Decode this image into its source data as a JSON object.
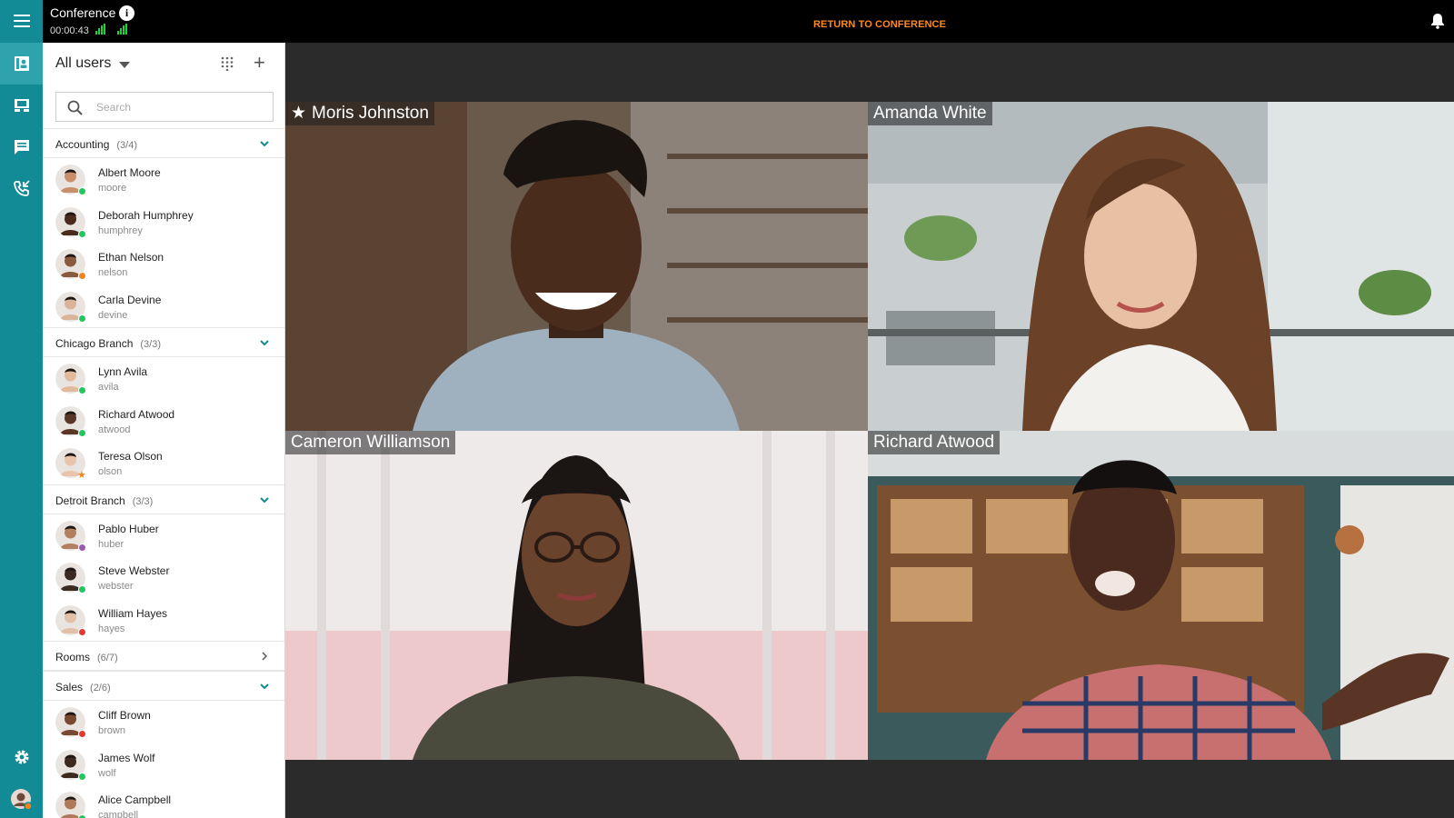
{
  "topbar": {
    "title": "Conference",
    "timer": "00:00:43",
    "return_label": "RETURN TO CONFERENCE"
  },
  "colors": {
    "accent": "#138b97",
    "accent_active": "#2ea2ad",
    "return_orange": "#ff8a1f",
    "online": "#22c55e",
    "away": "#f0861b",
    "busy": "#e53935",
    "dnd": "#9b59b6"
  },
  "rail": {
    "items": [
      "menu-icon",
      "contacts-icon",
      "rooms-icon",
      "chat-icon",
      "call-history-icon",
      "settings-icon",
      "user-avatar"
    ]
  },
  "panel": {
    "header": "All users",
    "search_placeholder": "Search",
    "groups": [
      {
        "name": "Accounting",
        "count": "(3/4)",
        "expanded": true,
        "users": [
          {
            "name": "Albert Moore",
            "login": "moore",
            "status": "online"
          },
          {
            "name": "Deborah Humphrey",
            "login": "humphrey",
            "status": "online"
          },
          {
            "name": "Ethan Nelson",
            "login": "nelson",
            "status": "away"
          },
          {
            "name": "Carla Devine",
            "login": "devine",
            "status": "online"
          }
        ]
      },
      {
        "name": "Chicago Branch",
        "count": "(3/3)",
        "expanded": true,
        "users": [
          {
            "name": "Lynn Avila",
            "login": "avila",
            "status": "online"
          },
          {
            "name": "Richard Atwood",
            "login": "atwood",
            "status": "mobile"
          },
          {
            "name": "Teresa Olson",
            "login": "olson",
            "status": "star"
          }
        ]
      },
      {
        "name": "Detroit Branch",
        "count": "(3/3)",
        "expanded": true,
        "users": [
          {
            "name": "Pablo Huber",
            "login": "huber",
            "status": "dnd"
          },
          {
            "name": "Steve Webster",
            "login": "webster",
            "status": "online"
          },
          {
            "name": "William Hayes",
            "login": "hayes",
            "status": "busy"
          }
        ]
      },
      {
        "name": "Rooms",
        "count": "(6/7)",
        "expanded": false,
        "users": []
      },
      {
        "name": "Sales",
        "count": "(2/6)",
        "expanded": true,
        "users": [
          {
            "name": "Cliff Brown",
            "login": "brown",
            "status": "busy"
          },
          {
            "name": "James Wolf",
            "login": "wolf",
            "status": "online"
          },
          {
            "name": "Alice Campbell",
            "login": "campbell",
            "status": "online"
          }
        ]
      }
    ]
  },
  "tiles": [
    {
      "name": "Moris Johnston",
      "starred": true
    },
    {
      "name": "Amanda White",
      "starred": false
    },
    {
      "name": "Cameron Williamson",
      "starred": false
    },
    {
      "name": "Richard Atwood",
      "starred": false
    }
  ]
}
